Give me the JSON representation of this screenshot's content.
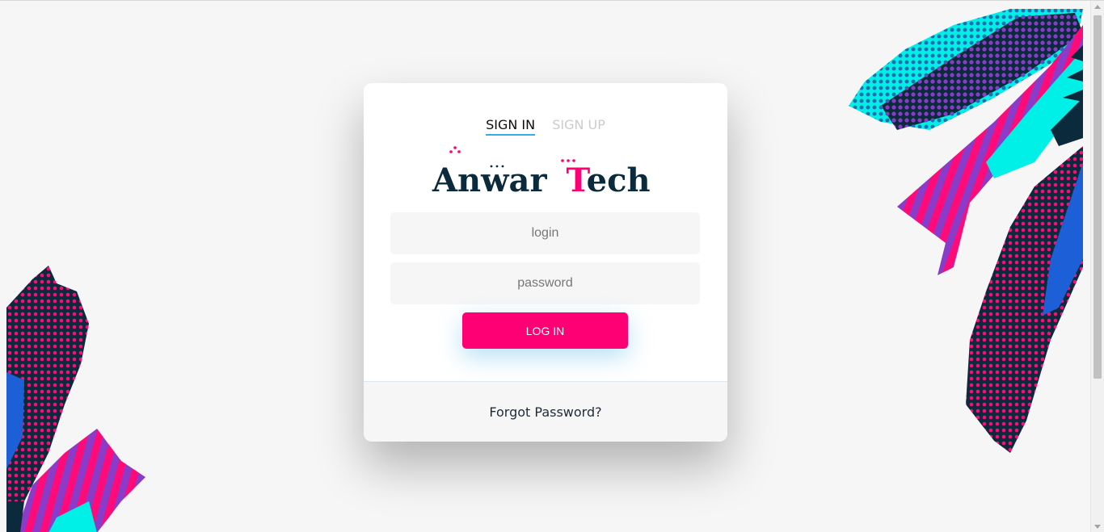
{
  "tabs": {
    "sign_in": "SIGN IN",
    "sign_up": "SIGN UP"
  },
  "logo": {
    "text_part1": "Anwar",
    "text_part2_letter": "T",
    "text_part2_rest": "ech"
  },
  "form": {
    "login_placeholder": "login",
    "password_placeholder": "password",
    "submit_label": "LOG IN"
  },
  "footer": {
    "forgot_password": "Forgot Password?"
  },
  "colors": {
    "accent_pink": "#ff0074",
    "tab_underline": "#39ace7",
    "navy": "#0b2b3c",
    "cyan": "#00f0e8",
    "purple": "#8a3cc8",
    "blue": "#1d5fd6"
  }
}
